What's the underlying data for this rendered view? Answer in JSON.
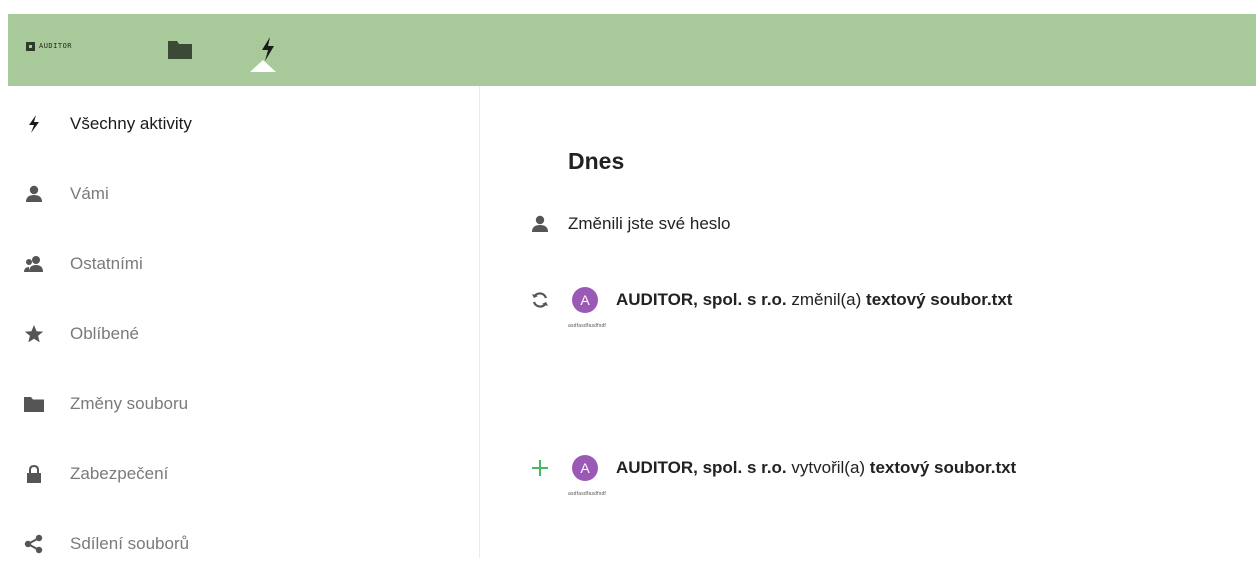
{
  "header": {
    "logo_text": "AUDITOR",
    "files_icon": "folder-icon",
    "activity_icon": "lightning-icon",
    "accent": "#a8c999"
  },
  "sidebar": {
    "items": [
      {
        "label": "Všechny aktivity",
        "icon": "lightning-icon",
        "active": true
      },
      {
        "label": "Vámi",
        "icon": "user-icon"
      },
      {
        "label": "Ostatními",
        "icon": "users-icon"
      },
      {
        "label": "Oblíbené",
        "icon": "star-icon"
      },
      {
        "label": "Změny souboru",
        "icon": "folder-icon"
      },
      {
        "label": "Zabezpečení",
        "icon": "lock-icon"
      },
      {
        "label": "Sdílení souborů",
        "icon": "share-icon"
      }
    ]
  },
  "main": {
    "section_title": "Dnes",
    "activities": [
      {
        "icon": "user-icon",
        "text": "Změnili jste své heslo"
      },
      {
        "icon": "refresh-icon",
        "avatar_letter": "A",
        "actor": "AUDITOR, spol. s r.o.",
        "verb": "změnil(a)",
        "object": "textový soubor.txt",
        "detail": "asdfasdfasdfsdf"
      },
      {
        "icon": "plus-icon",
        "avatar_letter": "A",
        "actor": "AUDITOR, spol. s r.o.",
        "verb": "vytvořil(a)",
        "object": "textový soubor.txt",
        "detail": "asdfasdfasdfsdf"
      }
    ]
  }
}
